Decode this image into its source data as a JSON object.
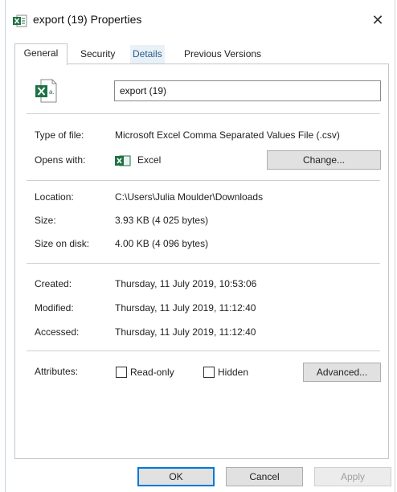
{
  "window": {
    "title": "export (19) Properties",
    "close_glyph": "✕",
    "icon": "excel-csv-icon"
  },
  "tabs": [
    {
      "label": "General",
      "active": true
    },
    {
      "label": "Security",
      "active": false
    },
    {
      "label": "Details",
      "active": false
    },
    {
      "label": "Previous Versions",
      "active": false
    }
  ],
  "general": {
    "file_name": "export (19)",
    "type_of_file_label": "Type of file:",
    "type_of_file_value": "Microsoft Excel Comma Separated Values File (.csv)",
    "opens_with_label": "Opens with:",
    "opens_with_value": "Excel",
    "change_button": "Change...",
    "location_label": "Location:",
    "location_value": "C:\\Users\\Julia Moulder\\Downloads",
    "size_label": "Size:",
    "size_value": "3.93 KB (4 025 bytes)",
    "size_on_disk_label": "Size on disk:",
    "size_on_disk_value": "4.00 KB (4 096 bytes)",
    "created_label": "Created:",
    "created_value": "Thursday, 11 July 2019, 10:53:06",
    "modified_label": "Modified:",
    "modified_value": "Thursday, 11 July 2019, 11:12:40",
    "accessed_label": "Accessed:",
    "accessed_value": "Thursday, 11 July 2019, 11:12:40",
    "attributes_label": "Attributes:",
    "readonly_label": "Read-only",
    "readonly_checked": false,
    "hidden_label": "Hidden",
    "hidden_checked": false,
    "advanced_button": "Advanced..."
  },
  "footer": {
    "ok": "OK",
    "cancel": "Cancel",
    "apply": "Apply"
  },
  "colors": {
    "excel_green": "#1e7145",
    "ok_border": "#0078d7",
    "details_tab_text": "#2b5c8a"
  }
}
